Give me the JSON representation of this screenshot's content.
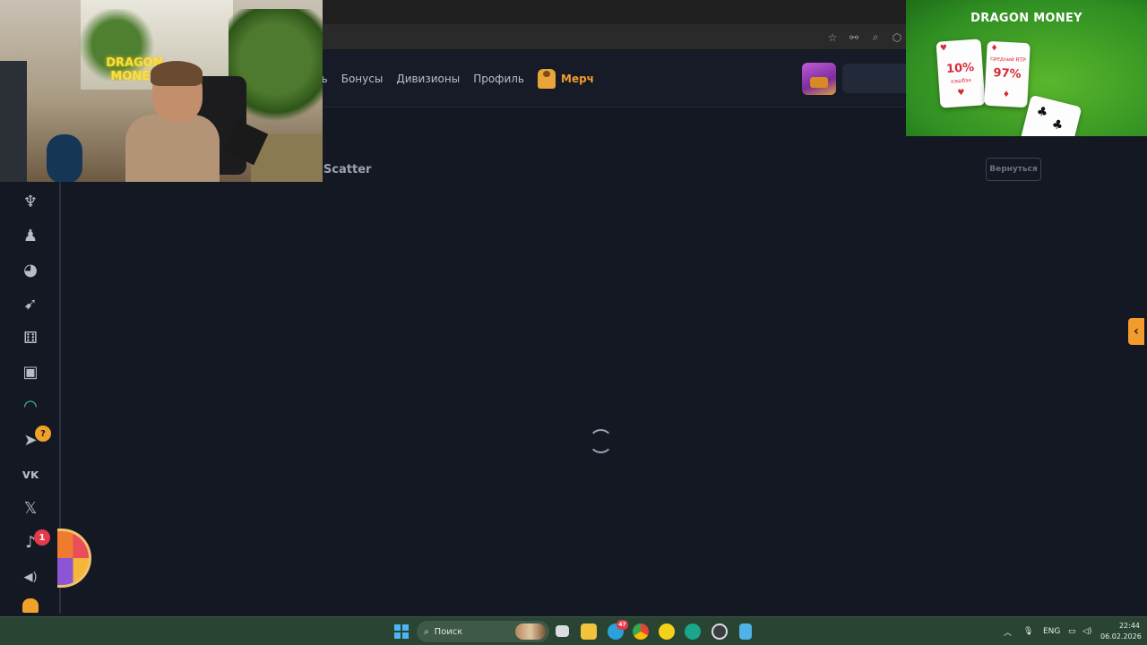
{
  "nav": {
    "items": [
      {
        "label": "ощь"
      },
      {
        "label": "Бонусы"
      },
      {
        "label": "Дивизионы"
      },
      {
        "label": "Профиль"
      }
    ],
    "merch_label": "Мерч"
  },
  "page": {
    "title": "r Scatter",
    "back_label": "Вернуться"
  },
  "sidebar": {
    "items": [
      {
        "icon": "dragon-icon",
        "glyph": "♆"
      },
      {
        "icon": "user-icon",
        "glyph": "♟"
      },
      {
        "icon": "joystick-icon",
        "glyph": "◕"
      },
      {
        "icon": "rocket-icon",
        "glyph": "➹"
      },
      {
        "icon": "dice-icon",
        "glyph": "⚅"
      },
      {
        "icon": "slot-machine-icon",
        "glyph": "▣"
      },
      {
        "icon": "support-headset-icon",
        "glyph": "◠"
      },
      {
        "icon": "telegram-icon",
        "glyph": "➤"
      },
      {
        "icon": "vk-icon",
        "glyph": "ᴠᴋ"
      },
      {
        "icon": "x-icon",
        "glyph": "𝕏"
      },
      {
        "icon": "bell-icon",
        "glyph": "♪"
      },
      {
        "icon": "volume-icon",
        "glyph": "◀)"
      }
    ],
    "telegram_badge": "?",
    "bell_badge": "1"
  },
  "webcam": {
    "neon_text": "DRAGON MONEY"
  },
  "ad": {
    "logo": "DRAGON MONEY",
    "card_1_value": "10%",
    "card_1_caption": "кэшбэк",
    "card_2_value": "97%",
    "card_2_caption": "средний RTP"
  },
  "taskbar": {
    "search_placeholder": "Поиск",
    "telegram_count": "47",
    "language": "ENG",
    "time": "22:44",
    "date": "06.02.2026"
  },
  "colors": {
    "accent": "#f39b2d",
    "page_bg": "#141823",
    "active_icon": "#3fd18b",
    "badge_red": "#e43a4a"
  }
}
